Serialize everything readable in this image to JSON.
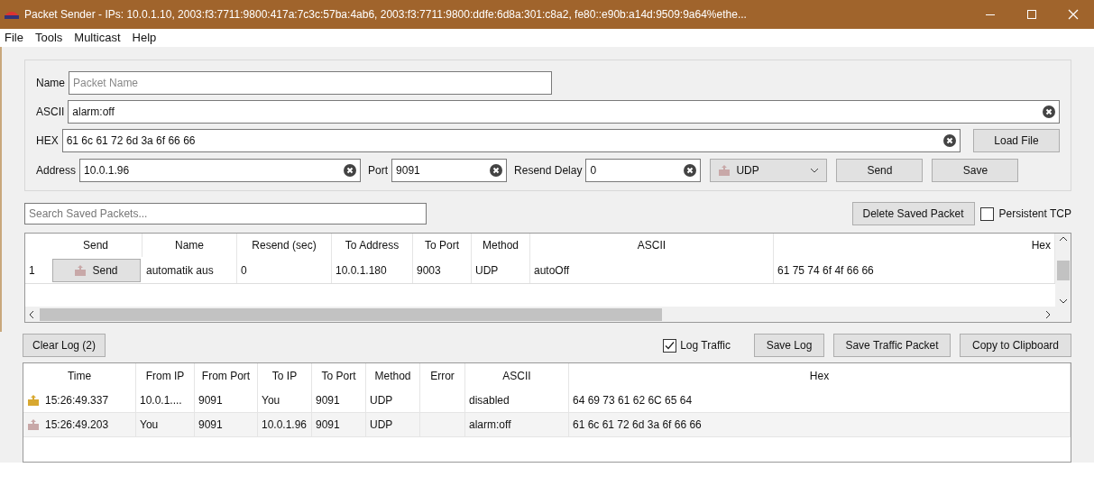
{
  "window": {
    "title": "Packet Sender - IPs: 10.0.1.10, 2003:f3:7711:9800:417a:7c3c:57ba:4ab6, 2003:f3:7711:9800:ddfe:6d8a:301:c8a2, fe80::e90b:a14d:9509:9a64%ethe..."
  },
  "menu": [
    "File",
    "Tools",
    "Multicast",
    "Help"
  ],
  "form": {
    "name": {
      "label": "Name",
      "placeholder": "Packet Name"
    },
    "ascii": {
      "label": "ASCII",
      "value": "alarm:off"
    },
    "hex": {
      "label": "HEX",
      "value": "61 6c 61 72 6d 3a 6f 66 66"
    },
    "load_file": "Load File",
    "address": {
      "label": "Address",
      "value": "10.0.1.96"
    },
    "port": {
      "label": "Port",
      "value": "9091"
    },
    "resend_delay": {
      "label": "Resend Delay",
      "value": "0"
    },
    "method": "UDP",
    "send": "Send",
    "save": "Save"
  },
  "saved": {
    "search": {
      "placeholder": "Search Saved Packets..."
    },
    "delete": "Delete Saved Packet",
    "persistent_tcp": {
      "label": "Persistent TCP",
      "checked": false
    },
    "columns": [
      "Send",
      "Name",
      "Resend (sec)",
      "To Address",
      "To Port",
      "Method",
      "ASCII",
      "Hex"
    ],
    "rows": [
      {
        "index": "1",
        "send": "Send",
        "name": "automatik aus",
        "resend": "0",
        "address": "10.0.1.180",
        "port": "9003",
        "method": "UDP",
        "ascii": "autoOff",
        "hex": "61 75 74 6f 4f 66 66"
      }
    ]
  },
  "log": {
    "clear": "Clear Log (2)",
    "log_traffic": {
      "label": "Log Traffic",
      "checked": true
    },
    "save_log": "Save Log",
    "save_traffic": "Save Traffic Packet",
    "copy": "Copy to Clipboard",
    "columns": [
      "Time",
      "From IP",
      "From Port",
      "To IP",
      "To Port",
      "Method",
      "Error",
      "ASCII",
      "Hex"
    ],
    "rows": [
      {
        "kind": "received",
        "cells": [
          "15:26:49.337",
          "10.0.1....",
          "9091",
          "You",
          "9091",
          "UDP",
          "",
          "disabled",
          "64 69 73 61 62 6C 65 64"
        ]
      },
      {
        "kind": "sent",
        "cells": [
          "15:26:49.203",
          "You",
          "9091",
          "10.0.1.96",
          "9091",
          "UDP",
          "",
          "alarm:off",
          "61 6c 61 72 6d 3a 6f 66 66"
        ]
      }
    ]
  }
}
